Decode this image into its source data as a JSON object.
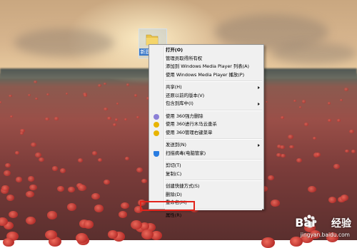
{
  "desktop": {
    "icon_label": "新建文件夹"
  },
  "context_menu": {
    "items": [
      {
        "label": "打开(O)",
        "bold": true
      },
      {
        "label": "管理员取得所有权"
      },
      {
        "label": "添加到 Windows Media Player 列表(A)"
      },
      {
        "label": "使用 Windows Media Player 播放(P)"
      },
      {
        "separator": true
      },
      {
        "label": "共享(H)",
        "submenu": true
      },
      {
        "label": "还原以前的版本(V)"
      },
      {
        "label": "包含到库中(I)",
        "submenu": true
      },
      {
        "separator": true
      },
      {
        "label": "使用 360强力删除",
        "icon": "shredder-icon",
        "icon_color": "#8b7fd6"
      },
      {
        "label": "使用 360进行木马云查杀",
        "icon": "trojan-scan-icon",
        "icon_color": "#e8b400"
      },
      {
        "label": "使用 360管理右键菜单",
        "icon": "menu-manager-icon",
        "icon_color": "#e8b400"
      },
      {
        "separator": true
      },
      {
        "label": "发送到(N)",
        "submenu": true
      },
      {
        "label": "扫描病毒(电脑管家)",
        "icon": "shield-icon",
        "icon_color": "#2a7de1"
      },
      {
        "separator": true
      },
      {
        "label": "剪切(T)"
      },
      {
        "label": "复制(C)"
      },
      {
        "separator": true
      },
      {
        "label": "创建快捷方式(S)"
      },
      {
        "label": "删除(D)"
      },
      {
        "label": "重命名(M)"
      },
      {
        "separator": true
      },
      {
        "label": "属性(R)",
        "highlighted": true
      }
    ]
  },
  "watermark": {
    "brand": "Bai",
    "brand_suffix": "经验",
    "url": "jingyan.baidu.com"
  },
  "colors": {
    "highlight": "#e2231a",
    "menu_bg": "#f0f0f0"
  }
}
